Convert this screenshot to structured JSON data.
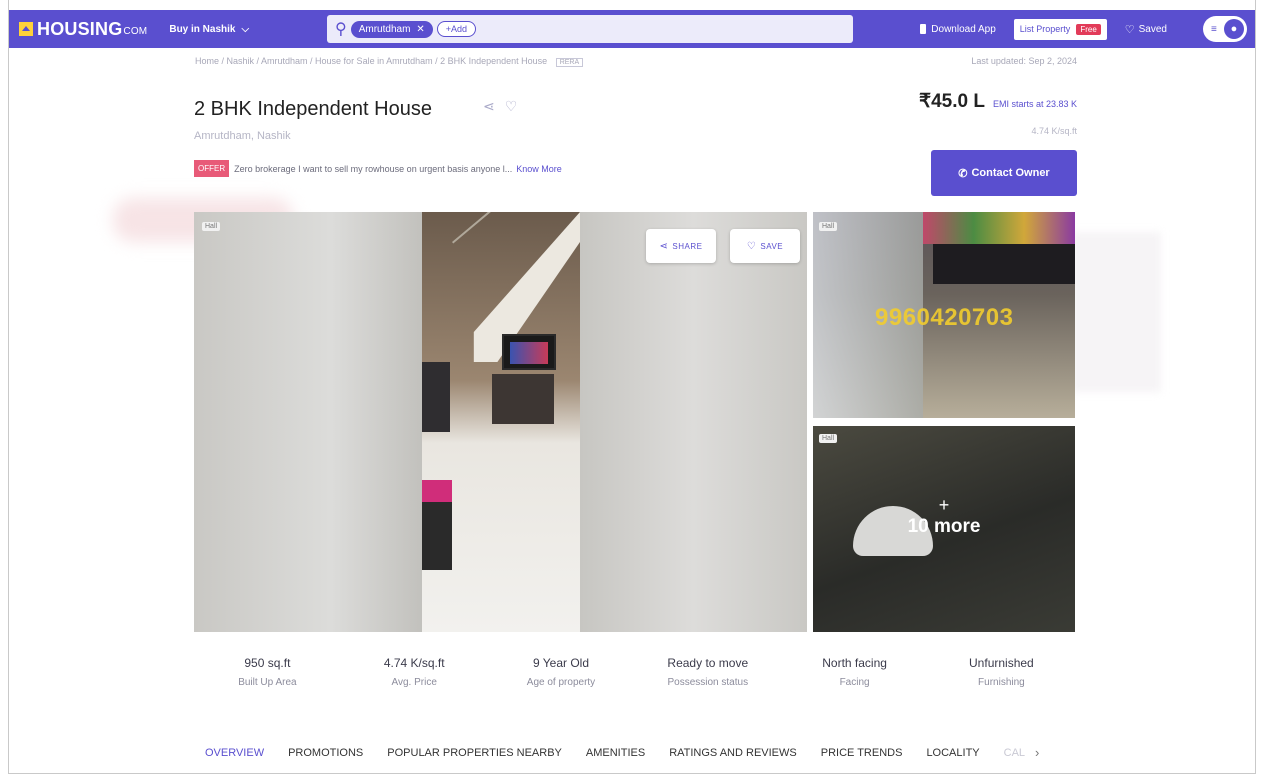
{
  "header": {
    "logo": "HOUSING",
    "logo_suffix": "COM",
    "buy_in": "Buy in Nashik",
    "search_chip": "Amrutdham",
    "add_chip": "+Add",
    "download_app": "Download App",
    "list_property": "List Property",
    "free_badge": "Free",
    "saved": "Saved"
  },
  "breadcrumb": {
    "text": "Home / Nashik / Amrutdham / House for Sale in Amrutdham / 2 BHK Independent House",
    "rera": "RERA",
    "last_updated": "Last updated: Sep 2, 2024"
  },
  "listing": {
    "title": "2 BHK Independent House",
    "locality": "Amrutdham, Nashik",
    "offer_badge": "OFFER",
    "offer_text": "Zero brokerage I want to sell my rowhouse on urgent basis anyone l...",
    "know_more": "Know More",
    "price": "₹45.0 L",
    "emi": "EMI starts at 23.83 K",
    "per_sqft": "4.74 K/sq.ft",
    "contact_button": "Contact Owner"
  },
  "gallery": {
    "main_tag": "Hall",
    "share": "SHARE",
    "save": "SAVE",
    "side1_tag": "Hall",
    "side1_watermark": "9960420703",
    "side2_tag": "Hall",
    "more_plus": "+",
    "more_text": "10 more"
  },
  "stats": [
    {
      "value": "950 sq.ft",
      "label": "Built Up Area"
    },
    {
      "value": "4.74 K/sq.ft",
      "label": "Avg. Price"
    },
    {
      "value": "9 Year Old",
      "label": "Age of property"
    },
    {
      "value": "Ready to move",
      "label": "Possession status"
    },
    {
      "value": "North facing",
      "label": "Facing"
    },
    {
      "value": "Unfurnished",
      "label": "Furnishing"
    }
  ],
  "tabs": [
    "OVERVIEW",
    "PROMOTIONS",
    "POPULAR PROPERTIES NEARBY",
    "AMENITIES",
    "RATINGS AND REVIEWS",
    "PRICE TRENDS",
    "LOCALITY",
    "CAL"
  ],
  "colors": {
    "brand": "#5a4fcf",
    "offer": "#e85a78",
    "watermark": "#f2cd2e"
  }
}
